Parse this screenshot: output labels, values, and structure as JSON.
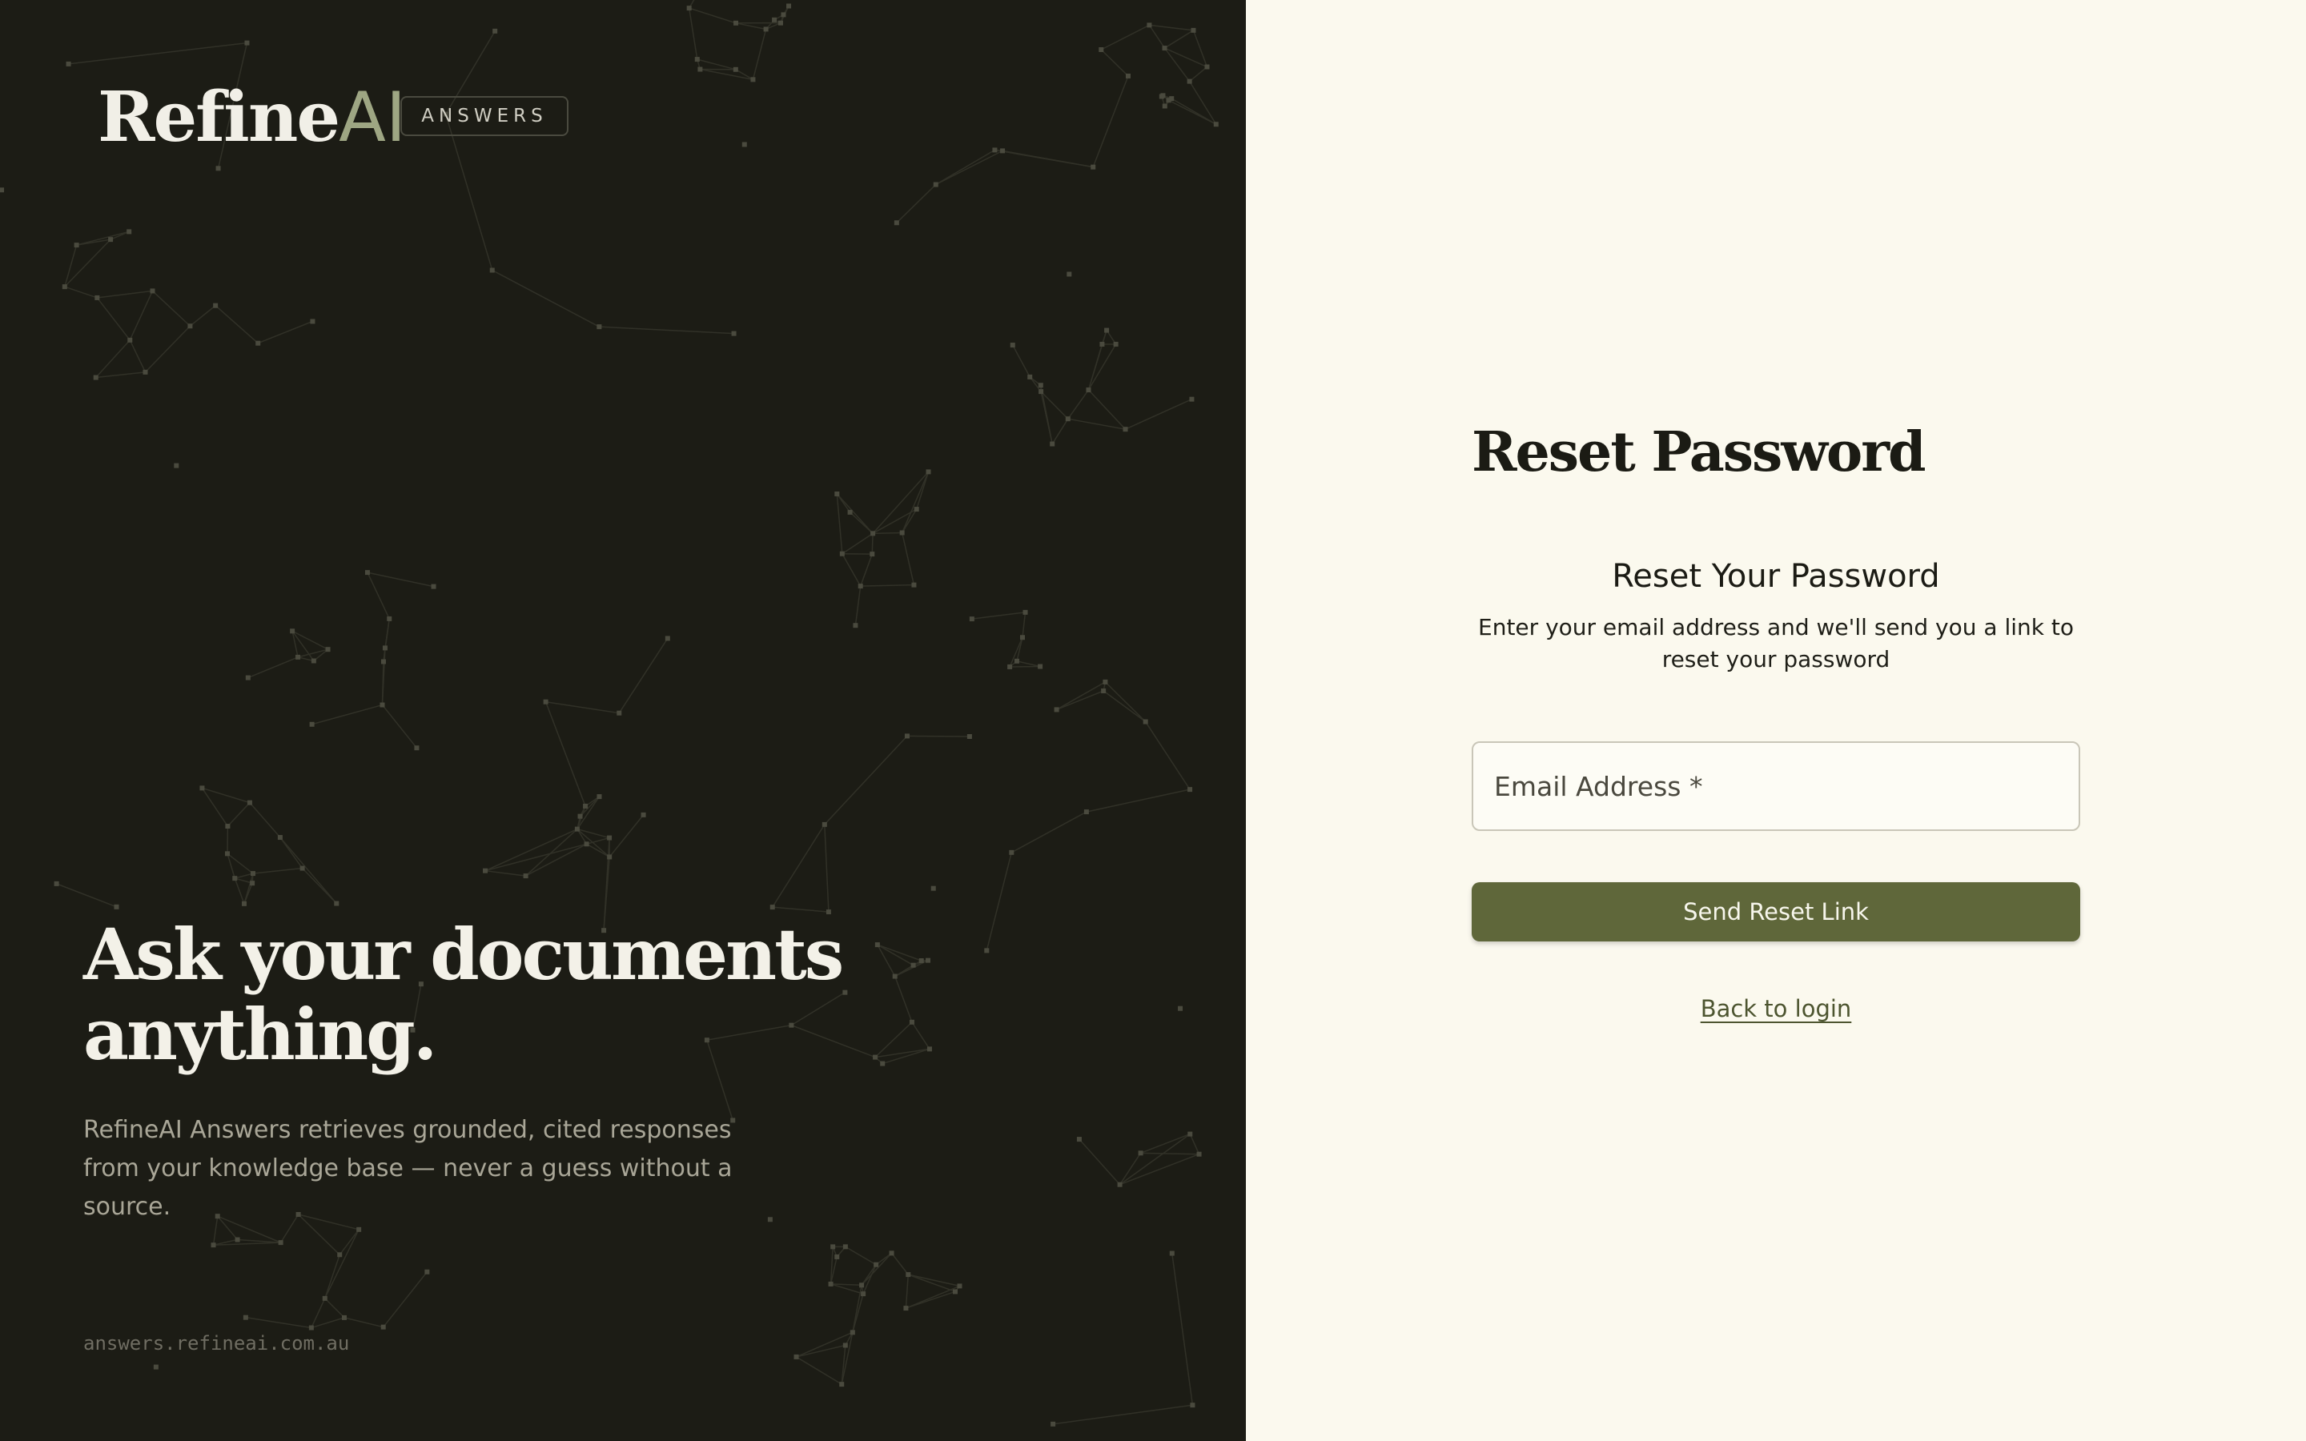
{
  "brand": {
    "logo_main": "Refine",
    "logo_accent": "AI",
    "badge": "ANSWERS",
    "colors": {
      "dark_bg": "#1c1c15",
      "light_bg": "#fbf9ee",
      "accent_olive": "#5f673a",
      "logo_accent": "#9ea683"
    }
  },
  "hero": {
    "title": "Ask your documents anything.",
    "subtitle": "RefineAI Answers retrieves grounded, cited responses from your knowledge base — never a guess without a source.",
    "url": "answers.refineai.com.au"
  },
  "form": {
    "page_title": "Reset Password",
    "section_title": "Reset Your Password",
    "description": "Enter your email address and we'll send you a link to reset your password",
    "email": {
      "placeholder": "Email Address *",
      "value": ""
    },
    "submit_label": "Send Reset Link",
    "back_link_label": "Back to login"
  }
}
